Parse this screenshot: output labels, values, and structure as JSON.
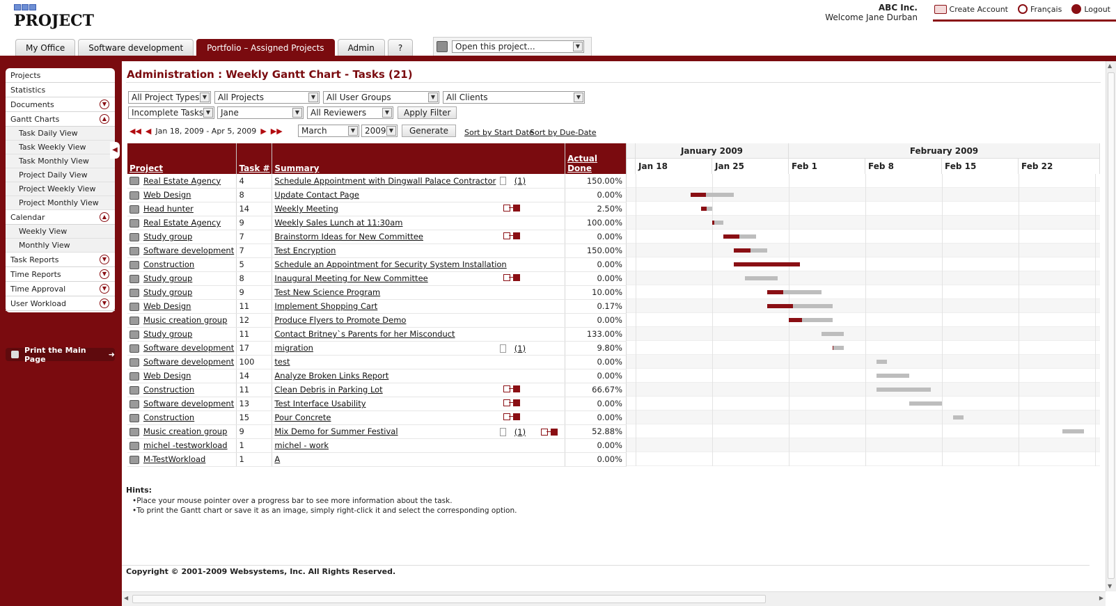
{
  "header": {
    "logo_text": "PROJECT",
    "company": "ABC Inc.",
    "welcome": "Welcome Jane Durban",
    "links": {
      "create_account": "Create Account",
      "francais": "Français",
      "logout": "Logout"
    }
  },
  "tabs": [
    {
      "label": "My Office"
    },
    {
      "label": "Software development"
    },
    {
      "label": "Portfolio – Assigned Projects"
    },
    {
      "label": "Admin"
    },
    {
      "label": "?"
    }
  ],
  "open_project": {
    "value": "Open this project..."
  },
  "sidebar": {
    "items": [
      {
        "label": "Projects"
      },
      {
        "label": "Statistics"
      },
      {
        "label": "Documents"
      },
      {
        "label": "Gantt Charts"
      },
      {
        "label": "Task Daily View"
      },
      {
        "label": "Task Weekly View"
      },
      {
        "label": "Task Monthly View"
      },
      {
        "label": "Project Daily View"
      },
      {
        "label": "Project Weekly View"
      },
      {
        "label": "Project Monthly View"
      },
      {
        "label": "Calendar"
      },
      {
        "label": "Weekly View"
      },
      {
        "label": "Monthly View"
      },
      {
        "label": "Task Reports"
      },
      {
        "label": "Time Reports"
      },
      {
        "label": "Time Approval"
      },
      {
        "label": "User Workload"
      }
    ],
    "print_label": "Print the Main Page"
  },
  "page_title": "Administration : Weekly Gantt Chart - Tasks (21)",
  "filters": {
    "project_types": "All Project Types",
    "projects": "All Projects",
    "user_groups": "All User Groups",
    "clients": "All Clients",
    "task_status": "Incomplete Tasks",
    "user": "Jane",
    "reviewers": "All Reviewers",
    "apply_label": "Apply Filter",
    "date_range": "Jan 18, 2009 - Apr 5, 2009",
    "month": "March",
    "year": "2009",
    "generate_label": "Generate",
    "sort_start": "Sort by Start Date",
    "sort_due": "Sort by Due-Date"
  },
  "table": {
    "headers": {
      "project": "Project",
      "task": "Task #",
      "summary": "Summary",
      "done": "Actual Done"
    },
    "rows": [
      {
        "project": "Real Estate Agency",
        "task": "4",
        "summary": "Schedule Appointment with Dingwall Palace Contractor",
        "note": "(1)",
        "dep": false,
        "done": "150.00%"
      },
      {
        "project": "Web Design",
        "task": "8",
        "summary": "Update Contact Page",
        "note": "",
        "dep": false,
        "done": "0.00%"
      },
      {
        "project": "Head hunter",
        "task": "14",
        "summary": "Weekly Meeting",
        "note": "",
        "dep": true,
        "done": "2.50%"
      },
      {
        "project": "Real Estate Agency",
        "task": "9",
        "summary": "Weekly Sales Lunch at 11:30am",
        "note": "",
        "dep": false,
        "done": "100.00%"
      },
      {
        "project": "Study group",
        "task": "7",
        "summary": "Brainstorm Ideas for New Committee",
        "note": "",
        "dep": true,
        "done": "0.00%"
      },
      {
        "project": "Software development",
        "task": "7",
        "summary": "Test Encryption",
        "note": "",
        "dep": false,
        "done": "150.00%"
      },
      {
        "project": "Construction",
        "task": "5",
        "summary": "Schedule an Appointment for Security System Installation",
        "note": "",
        "dep": false,
        "done": "0.00%"
      },
      {
        "project": "Study group",
        "task": "8",
        "summary": "Inaugural Meeting for New Committee",
        "note": "",
        "dep": true,
        "done": "0.00%"
      },
      {
        "project": "Study group",
        "task": "9",
        "summary": "Test New Science Program",
        "note": "",
        "dep": false,
        "done": "10.00%"
      },
      {
        "project": "Web Design",
        "task": "11",
        "summary": "Implement Shopping Cart",
        "note": "",
        "dep": false,
        "done": "0.17%"
      },
      {
        "project": "Music creation group",
        "task": "12",
        "summary": "Produce Flyers to Promote Demo",
        "note": "",
        "dep": false,
        "done": "0.00%"
      },
      {
        "project": "Study group",
        "task": "11",
        "summary": "Contact Britney`s Parents for her Misconduct",
        "note": "",
        "dep": false,
        "done": "133.00%"
      },
      {
        "project": "Software development",
        "task": "17",
        "summary": "migration",
        "note": "(1)",
        "dep": false,
        "done": "9.80%"
      },
      {
        "project": "Software development",
        "task": "100",
        "summary": "test",
        "note": "",
        "dep": false,
        "done": "0.00%"
      },
      {
        "project": "Web Design",
        "task": "14",
        "summary": "Analyze Broken Links Report",
        "note": "",
        "dep": false,
        "done": "0.00%"
      },
      {
        "project": "Construction",
        "task": "11",
        "summary": "Clean Debris in Parking Lot",
        "note": "",
        "dep": true,
        "done": "66.67%"
      },
      {
        "project": "Software development",
        "task": "13",
        "summary": "Test Interface Usability",
        "note": "",
        "dep": true,
        "done": "0.00%"
      },
      {
        "project": "Construction",
        "task": "15",
        "summary": "Pour Concrete",
        "note": "",
        "dep": true,
        "done": "0.00%"
      },
      {
        "project": "Music creation group",
        "task": "9",
        "summary": "Mix Demo for Summer Festival",
        "note": "(1)",
        "dep": true,
        "done": "52.88%"
      },
      {
        "project": "michel -testworkload",
        "task": "1",
        "summary": "michel - work",
        "note": "",
        "dep": false,
        "done": "0.00%"
      },
      {
        "project": "M-TestWorkload",
        "task": "1",
        "summary": "A",
        "note": "",
        "dep": false,
        "done": "0.00%"
      }
    ]
  },
  "gantt": {
    "months": [
      "January 2009",
      "February 2009"
    ],
    "weeks": [
      "Jan 18",
      "Jan 25",
      "Feb 1",
      "Feb 8",
      "Feb 15",
      "Feb 22"
    ],
    "bars": [
      {
        "start": "",
        "end": "",
        "progress": 0
      },
      {
        "start": "2009-01-23",
        "end": "2009-01-27",
        "progress": 0.35
      },
      {
        "start": "2009-01-24",
        "end": "2009-01-25",
        "progress": 0.5
      },
      {
        "start": "2009-01-25",
        "end": "2009-01-26",
        "progress": 0.2
      },
      {
        "start": "2009-01-26",
        "end": "2009-01-29",
        "progress": 0.5
      },
      {
        "start": "2009-01-27",
        "end": "2009-01-30",
        "progress": 0.5
      },
      {
        "start": "2009-01-27",
        "end": "2009-02-02",
        "progress": 1.0
      },
      {
        "start": "2009-01-28",
        "end": "2009-01-31",
        "progress": 0.0
      },
      {
        "start": "2009-01-30",
        "end": "2009-02-04",
        "progress": 0.3
      },
      {
        "start": "2009-01-30",
        "end": "2009-02-05",
        "progress": 0.4
      },
      {
        "start": "2009-02-01",
        "end": "2009-02-05",
        "progress": 0.3
      },
      {
        "start": "2009-02-04",
        "end": "2009-02-06",
        "progress": 0.0
      },
      {
        "start": "2009-02-05",
        "end": "2009-02-06",
        "progress": 0.1
      },
      {
        "start": "2009-02-09",
        "end": "2009-02-10",
        "progress": 0.0
      },
      {
        "start": "2009-02-09",
        "end": "2009-02-12",
        "progress": 0.0
      },
      {
        "start": "2009-02-09",
        "end": "2009-02-14",
        "progress": 0.0
      },
      {
        "start": "2009-02-12",
        "end": "2009-02-15",
        "progress": 0.0
      },
      {
        "start": "2009-02-16",
        "end": "2009-02-17",
        "progress": 0.0
      },
      {
        "start": "2009-02-26",
        "end": "2009-02-28",
        "progress": 0.0
      },
      {
        "start": "",
        "end": "",
        "progress": 0
      },
      {
        "start": "",
        "end": "",
        "progress": 0
      }
    ]
  },
  "hints": {
    "title": "Hints:",
    "items": [
      "Place your mouse pointer over a progress bar to see more information about the task.",
      "To print the Gantt chart or save it as an image, simply right-click it and select the corresponding option."
    ]
  },
  "copyright": "Copyright © 2001-2009 Websystems, Inc. All Rights Reserved.",
  "colors": {
    "brand": "#7a0b0f",
    "progress": "#8a0f14",
    "bar": "#bdbdbd"
  }
}
